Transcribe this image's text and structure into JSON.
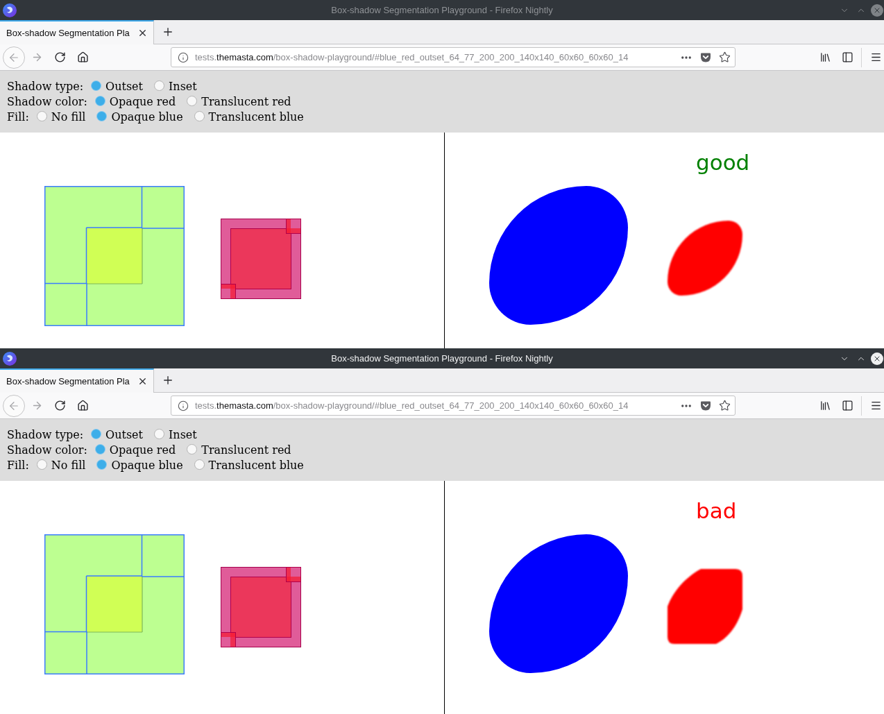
{
  "windows": [
    {
      "active": false,
      "title": "Box-shadow Segmentation Playground - Firefox Nightly",
      "tabs": [
        {
          "label": "Box-shadow Segmentation Pla",
          "selected": true
        }
      ],
      "nav_buttons": [
        {
          "kind": "back",
          "disabled": true
        },
        {
          "kind": "forward",
          "disabled": true
        },
        {
          "kind": "reload",
          "disabled": false
        },
        {
          "kind": "home",
          "disabled": false
        }
      ],
      "url": [
        {
          "text": "tests.",
          "emphasis": false
        },
        {
          "text": "themasta.com",
          "emphasis": true
        },
        {
          "text": "/box-shadow-playground/#blue_red_outset_64_77_200_200_140x140_60x60_60x60_14",
          "emphasis": false
        }
      ],
      "controls": [
        {
          "label": "Shadow type:",
          "options": [
            {
              "label": "Outset",
              "selected": true
            },
            {
              "label": "Inset",
              "selected": false
            }
          ]
        },
        {
          "label": "Shadow color:",
          "options": [
            {
              "label": "Opaque red",
              "selected": true
            },
            {
              "label": "Translucent red",
              "selected": false
            }
          ]
        },
        {
          "label": "Fill:",
          "options": [
            {
              "label": "No fill",
              "selected": false
            },
            {
              "label": "Opaque blue",
              "selected": true
            },
            {
              "label": "Translucent blue",
              "selected": false
            }
          ]
        }
      ],
      "verdict": {
        "text": "good",
        "color": "#008000"
      },
      "shadow_shape": {
        "kind": "leaf"
      }
    },
    {
      "active": true,
      "title": "Box-shadow Segmentation Playground - Firefox Nightly",
      "tabs": [
        {
          "label": "Box-shadow Segmentation Pla",
          "selected": true
        }
      ],
      "nav_buttons": [
        {
          "kind": "back",
          "disabled": true
        },
        {
          "kind": "forward",
          "disabled": true
        },
        {
          "kind": "reload",
          "disabled": false
        },
        {
          "kind": "home",
          "disabled": false
        }
      ],
      "url": [
        {
          "text": "tests.",
          "emphasis": false
        },
        {
          "text": "themasta.com",
          "emphasis": true
        },
        {
          "text": "/box-shadow-playground/#blue_red_outset_64_77_200_200_140x140_60x60_60x60_14",
          "emphasis": false
        }
      ],
      "controls": [
        {
          "label": "Shadow type:",
          "options": [
            {
              "label": "Outset",
              "selected": true
            },
            {
              "label": "Inset",
              "selected": false
            }
          ]
        },
        {
          "label": "Shadow color:",
          "options": [
            {
              "label": "Opaque red",
              "selected": true
            },
            {
              "label": "Translucent red",
              "selected": false
            }
          ]
        },
        {
          "label": "Fill:",
          "options": [
            {
              "label": "No fill",
              "selected": false
            },
            {
              "label": "Opaque blue",
              "selected": true
            },
            {
              "label": "Translucent blue",
              "selected": false
            }
          ]
        }
      ],
      "verdict": {
        "text": "bad",
        "color": "#ff0000"
      },
      "shadow_shape": {
        "kind": "blocky"
      }
    }
  ]
}
